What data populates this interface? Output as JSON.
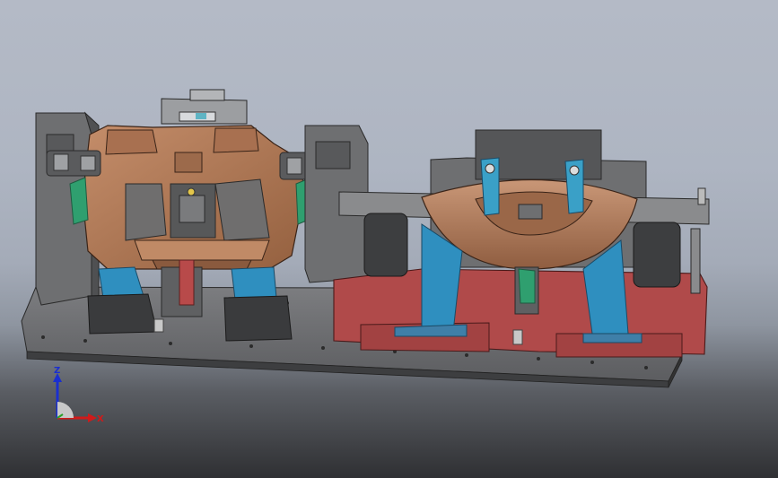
{
  "viewport": {
    "model_view": "fixture-assembly-isometric-view"
  },
  "triad": {
    "z_label": "Z",
    "x_label": "X",
    "colors": {
      "z": "#1a2fd0",
      "x": "#d01a1a",
      "y": "#2aa02a",
      "hub": "#c8c8c8"
    }
  },
  "model_colors": {
    "base_plate": "#6f7072",
    "housing_dark": "#4a4b4d",
    "part_copper": "#b07a5a",
    "clamp_blue": "#2f8fbf",
    "block_red": "#b04a4a",
    "latch_green": "#2f9f6f"
  }
}
